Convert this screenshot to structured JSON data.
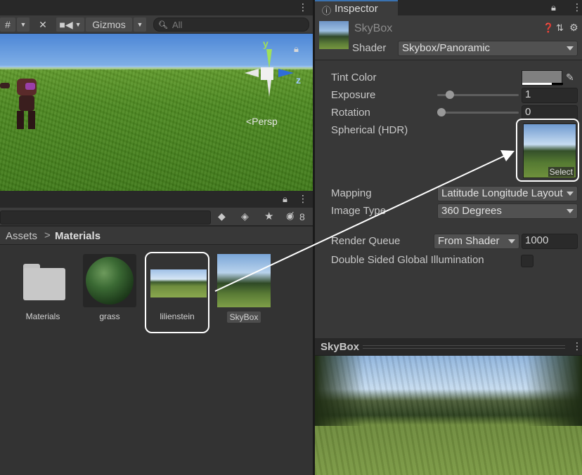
{
  "scene": {
    "toolbar": {
      "gizmos_label": "Gizmos",
      "search_placeholder": "All"
    },
    "persp_label": "<Persp",
    "axis_y": "y",
    "axis_z": "z"
  },
  "project": {
    "breadcrumb": {
      "root": "Assets",
      "separator": ">",
      "current": "Materials"
    },
    "hidden_count": "8",
    "assets": [
      {
        "name": "Materials",
        "type": "folder"
      },
      {
        "name": "grass",
        "type": "material"
      },
      {
        "name": "lilienstein",
        "type": "texture"
      },
      {
        "name": "SkyBox",
        "type": "material"
      }
    ]
  },
  "inspector": {
    "tab_label": "Inspector",
    "object_name": "SkyBox",
    "shader_label": "Shader",
    "shader_value": "Skybox/Panoramic",
    "properties": {
      "tint_color_label": "Tint Color",
      "exposure_label": "Exposure",
      "exposure_value": "1",
      "exposure_slider_fraction": 0.12,
      "rotation_label": "Rotation",
      "rotation_value": "0",
      "rotation_slider_fraction": 0.0,
      "spherical_label": "Spherical  (HDR)",
      "select_label": "Select",
      "mapping_label": "Mapping",
      "mapping_value": "Latitude Longitude Layout",
      "image_type_label": "Image Type",
      "image_type_value": "360 Degrees",
      "render_queue_label": "Render Queue",
      "render_queue_mode": "From Shader",
      "render_queue_value": "1000",
      "double_sided_gi_label": "Double Sided Global Illumination"
    }
  },
  "preview": {
    "title": "SkyBox"
  },
  "colors": {
    "accent_blue": "#3a72b0",
    "highlight_outline": "#ffffff",
    "tint_swatch": "#808080"
  }
}
